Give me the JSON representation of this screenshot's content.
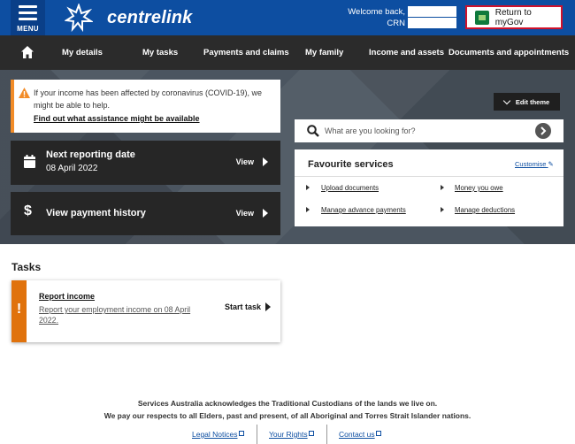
{
  "header": {
    "menu_label": "MENU",
    "brand": "centrelink",
    "welcome": "Welcome back,",
    "crn_label": "CRN",
    "return_button": "Return to myGov"
  },
  "nav": {
    "items": [
      "My details",
      "My tasks",
      "Payments and claims",
      "My family",
      "Income and assets",
      "Documents and appointments"
    ]
  },
  "alert": {
    "message": "If your income has been affected by coronavirus (COVID-19), we might be able to help.",
    "link": "Find out what assistance might be available"
  },
  "reporting": {
    "title": "Next reporting date",
    "date": "08 April 2022",
    "view": "View"
  },
  "payment_history": {
    "title": "View payment history",
    "view": "View"
  },
  "edit_theme": "Edit theme",
  "search": {
    "placeholder": "What are you looking for?"
  },
  "favourites": {
    "title": "Favourite services",
    "customise": "Customise",
    "services": [
      "Upload documents",
      "Money you owe",
      "Manage advance payments",
      "Manage deductions"
    ]
  },
  "tasks": {
    "heading": "Tasks",
    "items": [
      {
        "title": "Report income",
        "description": "Report your employment income on 08 April 2022.",
        "action": "Start task"
      }
    ]
  },
  "footer": {
    "ack_line1": "Services Australia acknowledges the Traditional Custodians of the lands we live on.",
    "ack_line2": "We pay our respects to all Elders, past and present, of all Aboriginal and Torres Strait Islander nations.",
    "links": [
      "Legal Notices",
      "Your Rights",
      "Contact us"
    ]
  },
  "colors": {
    "brand_blue": "#0d4ea1",
    "nav_dark": "#2b2b2b",
    "alert_orange": "#f28c28",
    "task_orange": "#e0720c",
    "return_border": "#d0112b"
  }
}
